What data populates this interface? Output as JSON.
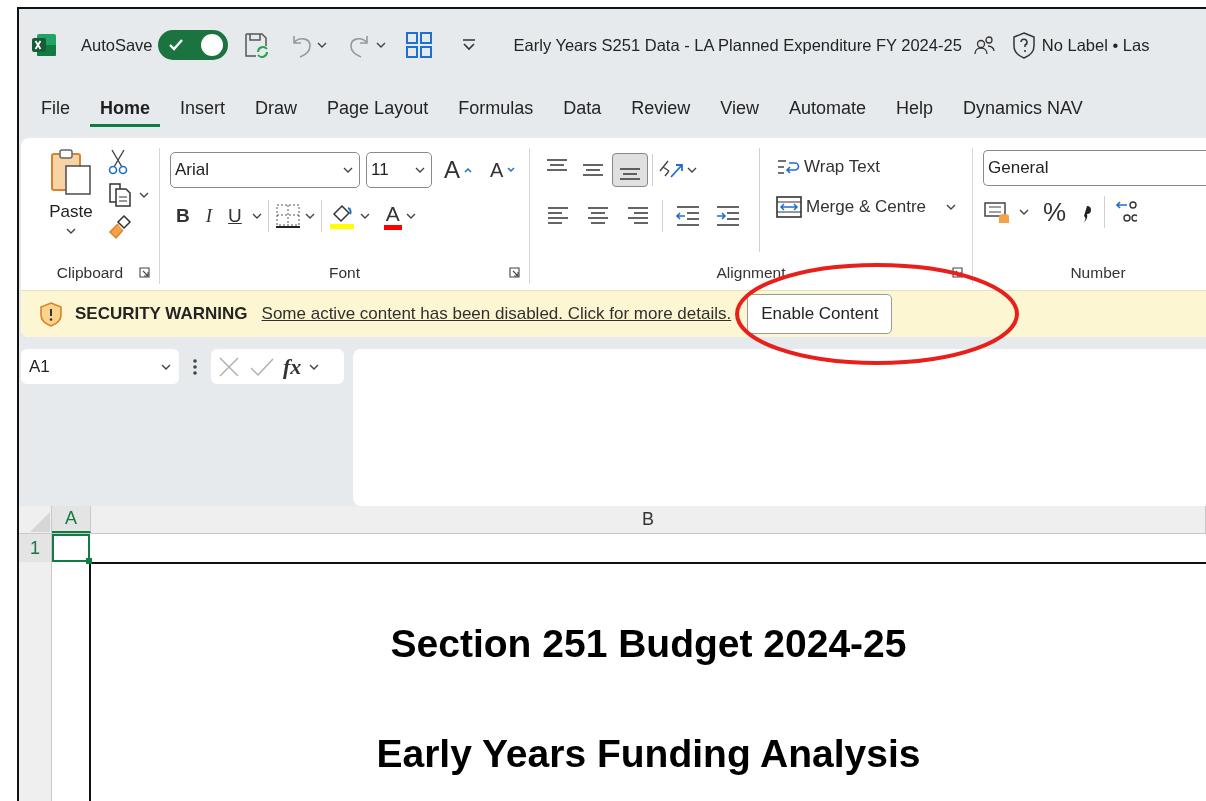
{
  "window": {
    "title": "Early Years S251 Data - LA Planned Expenditure FY 2024-25",
    "autosave_label": "AutoSave",
    "autosave_on": true,
    "sensitivity": "No Label • Las"
  },
  "tabs": [
    {
      "label": "File",
      "selected": false
    },
    {
      "label": "Home",
      "selected": true
    },
    {
      "label": "Insert",
      "selected": false
    },
    {
      "label": "Draw",
      "selected": false
    },
    {
      "label": "Page Layout",
      "selected": false
    },
    {
      "label": "Formulas",
      "selected": false
    },
    {
      "label": "Data",
      "selected": false
    },
    {
      "label": "Review",
      "selected": false
    },
    {
      "label": "View",
      "selected": false
    },
    {
      "label": "Automate",
      "selected": false
    },
    {
      "label": "Help",
      "selected": false
    },
    {
      "label": "Dynamics NAV",
      "selected": false
    }
  ],
  "clipboard": {
    "label": "Clipboard",
    "paste": "Paste"
  },
  "font": {
    "label": "Font",
    "family": "Arial",
    "size": "11",
    "grow": "A",
    "shrink": "A",
    "bold": "B",
    "italic": "I",
    "underline": "U",
    "font_color": "A"
  },
  "alignment": {
    "label": "Alignment",
    "vertical": [
      {
        "kind": "top",
        "selected": false
      },
      {
        "kind": "middle",
        "selected": false
      },
      {
        "kind": "bottom",
        "selected": true
      }
    ],
    "wrap_text": "Wrap Text",
    "merge": "Merge & Centre"
  },
  "number": {
    "label": "Number",
    "format": "General",
    "percent": "%"
  },
  "security_bar": {
    "title": "SECURITY WARNING",
    "message": "Some active content has been disabled. Click for more details.",
    "button": "Enable Content"
  },
  "formula_bar": {
    "name_box": "A1",
    "function": "fx"
  },
  "grid": {
    "columns": [
      {
        "label": "A",
        "selected": true
      },
      {
        "label": "B",
        "selected": false
      }
    ],
    "rows": [
      {
        "label": "1",
        "selected": true
      }
    ]
  },
  "sheet": {
    "title": "Section 251 Budget 2024-25",
    "subtitle": "Early Years Funding Analysis"
  }
}
